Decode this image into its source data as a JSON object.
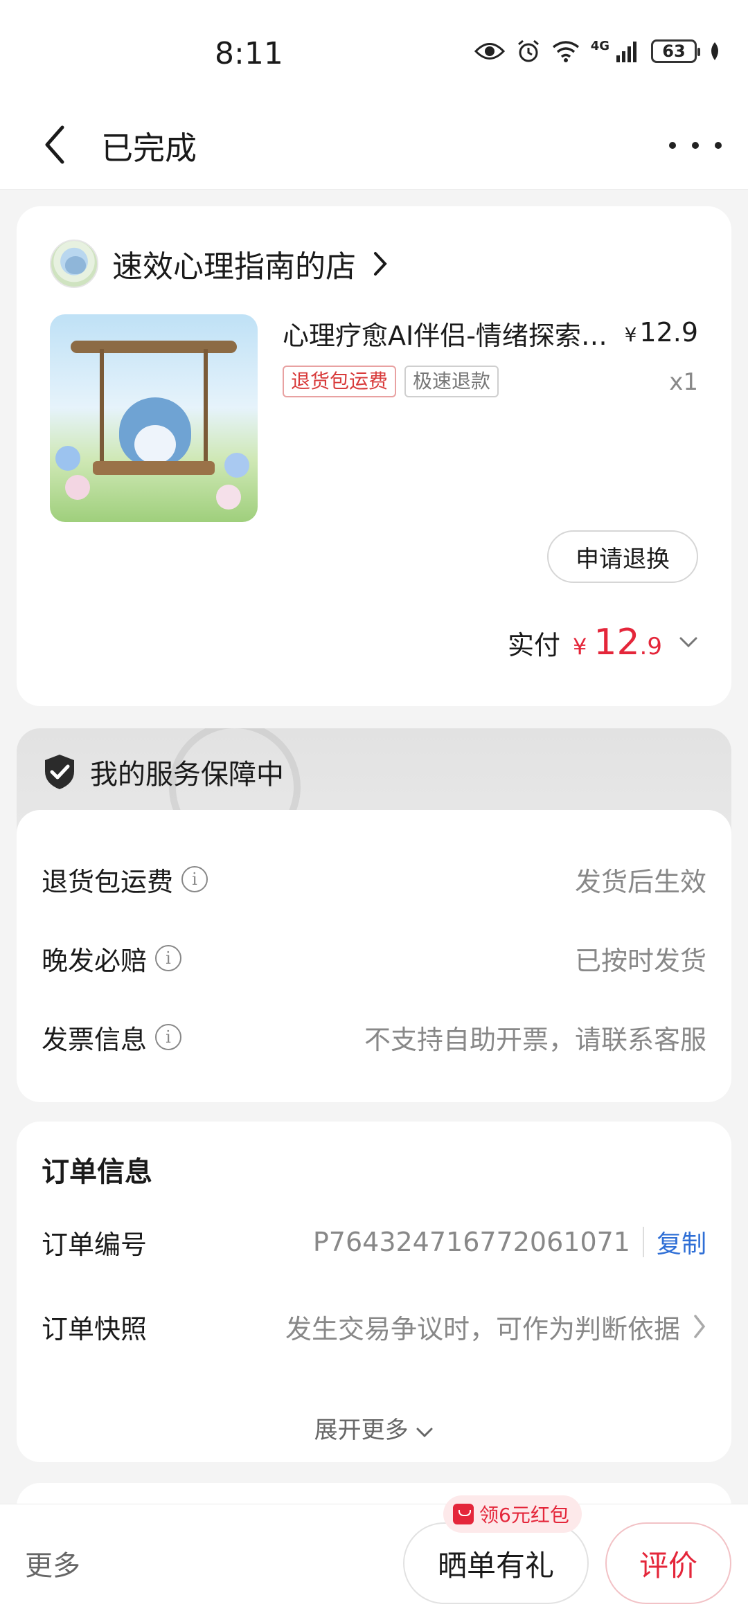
{
  "status_bar": {
    "time": "8:11",
    "battery": "63",
    "network": "4G"
  },
  "header": {
    "title": "已完成"
  },
  "store": {
    "shop_name": "速效心理指南的店",
    "product": {
      "title": "心理疗愈AI伴侣-情绪探索与心理咨询",
      "currency": "¥",
      "price": "12.9",
      "quantity": "x1",
      "tags": [
        "退货包运费",
        "极速退款"
      ]
    },
    "refund_button": "申请退换",
    "paid": {
      "label": "实付",
      "currency": "¥",
      "integer": "12",
      "decimal": ".9"
    }
  },
  "service": {
    "title": "我的服务保障中",
    "rows": [
      {
        "label": "退货包运费",
        "value": "发货后生效"
      },
      {
        "label": "晚发必赔",
        "value": "已按时发货"
      },
      {
        "label": "发票信息",
        "value": "不支持自助开票，请联系客服"
      }
    ]
  },
  "order": {
    "title": "订单信息",
    "number_label": "订单编号",
    "number_value": "P764324716772061071",
    "copy_label": "复制",
    "snapshot_label": "订单快照",
    "snapshot_value": "发生交易争议时，可作为判断依据",
    "expand_label": "展开更多"
  },
  "bottom_bar": {
    "more_label": "更多",
    "promo_badge": "领6元红包",
    "share_button": "晒单有礼",
    "review_button": "评价"
  },
  "colors": {
    "accent_red": "#e4263a",
    "link_blue": "#2f6fd6",
    "muted_text": "#888888"
  }
}
